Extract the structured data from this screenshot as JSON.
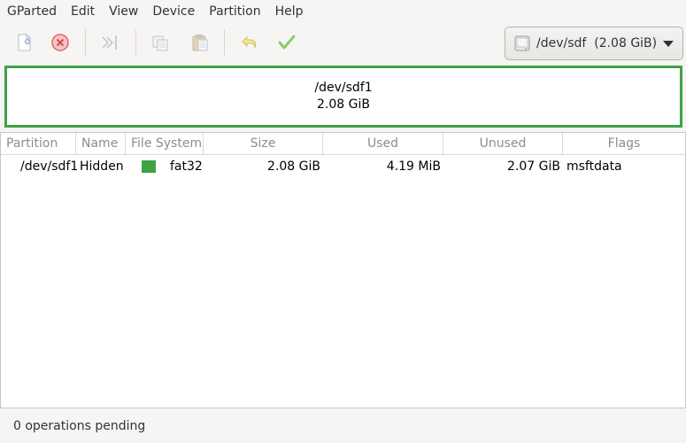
{
  "menubar": {
    "items": [
      "GParted",
      "Edit",
      "View",
      "Device",
      "Partition",
      "Help"
    ]
  },
  "toolbar": {
    "buttons": [
      {
        "name": "new-partition",
        "icon": "document-new-icon"
      },
      {
        "name": "delete-partition",
        "icon": "delete-icon"
      },
      {
        "name": "resize-move",
        "icon": "resize-move-icon"
      },
      {
        "name": "copy",
        "icon": "copy-icon"
      },
      {
        "name": "paste",
        "icon": "paste-icon"
      },
      {
        "name": "undo",
        "icon": "undo-icon"
      },
      {
        "name": "apply",
        "icon": "check-icon"
      }
    ],
    "device_selector": {
      "label": "/dev/sdf  (2.08 GiB)",
      "icon": "disk-icon"
    }
  },
  "disk_visual": {
    "partition_name": "/dev/sdf1",
    "partition_size": "2.08 GiB",
    "color": "#3fa244"
  },
  "table": {
    "columns": [
      "Partition",
      "Name",
      "File System",
      "Size",
      "Used",
      "Unused",
      "Flags"
    ],
    "rows": [
      {
        "partition": "/dev/sdf1",
        "name": "Hidden",
        "filesystem": "fat32",
        "fs_color": "#3fa244",
        "size": "2.08 GiB",
        "used": "4.19 MiB",
        "unused": "2.07 GiB",
        "flags": "msftdata"
      }
    ]
  },
  "status": {
    "text": "0 operations pending"
  }
}
